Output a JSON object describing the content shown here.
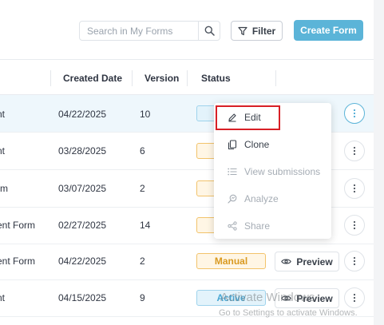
{
  "toolbar": {
    "search_placeholder": "Search in My Forms",
    "filter_label": "Filter",
    "create_label": "Create Form"
  },
  "table": {
    "columns": [
      "Created Date",
      "Version",
      "Status"
    ],
    "rows": [
      {
        "name": "nt",
        "date": "04/22/2025",
        "version": "10",
        "status": "",
        "status_type": "active",
        "preview": "",
        "highlight": true
      },
      {
        "name": "nt",
        "date": "03/28/2025",
        "version": "6",
        "status": "",
        "status_type": "manual",
        "preview": ""
      },
      {
        "name": "rm",
        "date": "03/07/2025",
        "version": "2",
        "status": "",
        "status_type": "manual",
        "preview": ""
      },
      {
        "name": "ent Form",
        "date": "02/27/2025",
        "version": "14",
        "status": "",
        "status_type": "manual",
        "preview": ""
      },
      {
        "name": "ent Form",
        "date": "04/22/2025",
        "version": "2",
        "status": "Manual",
        "status_type": "manual",
        "preview": "Preview"
      },
      {
        "name": "nt",
        "date": "04/15/2025",
        "version": "9",
        "status": "Active",
        "status_type": "active",
        "preview": "Preview"
      }
    ]
  },
  "menu": {
    "items": [
      {
        "label": "Edit",
        "icon": "pencil-icon",
        "enabled": true
      },
      {
        "label": "Clone",
        "icon": "copy-icon",
        "enabled": true
      },
      {
        "label": "View submissions",
        "icon": "list-icon",
        "enabled": false
      },
      {
        "label": "Analyze",
        "icon": "analyze-icon",
        "enabled": false
      },
      {
        "label": "Share",
        "icon": "share-icon",
        "enabled": false
      }
    ]
  },
  "watermark": {
    "line1": "Activate Windows",
    "line2": "Go to Settings to activate Windows."
  },
  "colors": {
    "accent": "#5bb4d8",
    "highlight_outline": "#d81f26",
    "active_badge": "#4aa8d4",
    "manual_badge": "#d99a21"
  }
}
